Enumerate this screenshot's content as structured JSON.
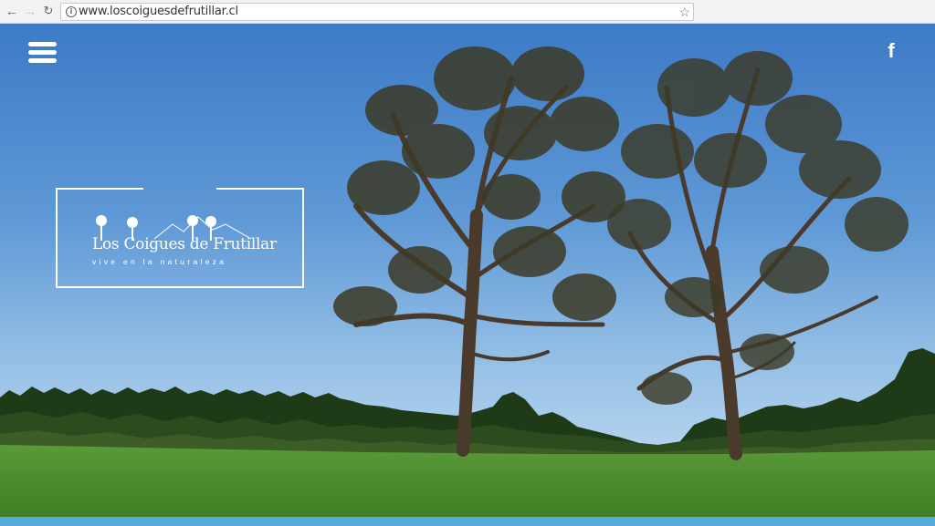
{
  "browser": {
    "url": "www.loscoiguesdefrutillar.cl",
    "back_icon": "arrow-left",
    "forward_icon": "arrow-right",
    "reload_icon": "reload",
    "info_icon": "info",
    "bookmark_icon": "star"
  },
  "site": {
    "menu_icon": "hamburger-menu",
    "social_icon": "facebook",
    "social_label": "f",
    "logo": {
      "name": "Los Coigues de Frutillar",
      "tagline": "vive en la naturaleza"
    },
    "colors": {
      "sky_top": "#3f7fc9",
      "sky_bottom": "#a9cdea",
      "grass": "#4e8f32",
      "forest": "#1f3b18",
      "accent_bar": "#58a9db"
    }
  }
}
